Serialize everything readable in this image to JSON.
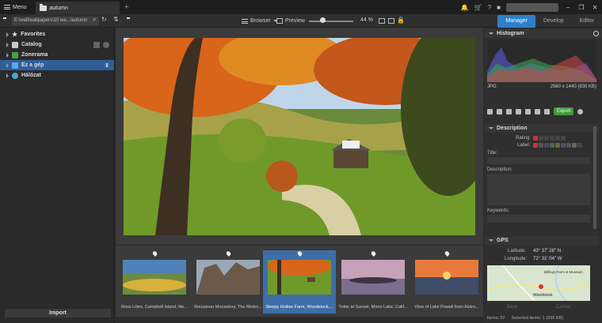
{
  "titlebar": {
    "menu_label": "Menu",
    "tab_label": "autumn",
    "add_tab": "+",
    "icons": [
      "bell-icon",
      "cart-icon",
      "help-icon",
      "gift-icon"
    ],
    "window_controls": [
      "–",
      "❐",
      "✕"
    ]
  },
  "toolbar": {
    "path": "E:\\wall\\wallpapers\\10 wa...\\autumn",
    "browser_label": "Browser",
    "preview_label": "Preview",
    "zoom_value": "44 %",
    "zoom_fraction": 0.3
  },
  "modes": {
    "manager": "Manager",
    "develop": "Develop",
    "editor": "Editor"
  },
  "sidebar": {
    "items": [
      {
        "label": "Favorites",
        "color": "#e0e0e0"
      },
      {
        "label": "Catalog",
        "color": "#c8c8c8"
      },
      {
        "label": "Zonerama",
        "color": "#3fa447"
      },
      {
        "label": "Ez a gép",
        "color": "#59a8e8"
      },
      {
        "label": "Hálózat",
        "color": "#4aa6d8"
      }
    ],
    "import_label": "Import"
  },
  "filmstrip": [
    {
      "caption": "Ross Lilies, Campbell Island, Ne..."
    },
    {
      "caption": "Rousanou Monastery, The Meteo..."
    },
    {
      "caption": "Sleepy Hollow Farm, Woodstock,..."
    },
    {
      "caption": "Tufas at Sunset, Mono Lake, Calif..."
    },
    {
      "caption": "View of Lake Powell from Alstro..."
    }
  ],
  "right": {
    "histogram_title": "Histogram",
    "file_type": "JPG",
    "file_dims": "2560 x 1440 (930 KB)",
    "export_label": "Export",
    "description_title": "Description",
    "rating_label": "Rating:",
    "label_label": "Label:",
    "title_label": "Title:",
    "desc_label": "Description:",
    "keywords_label": "Keywords:",
    "gps_title": "GPS",
    "latitude_label": "Latitude:",
    "latitude_value": "43° 37' 28\" N",
    "longitude_label": "Longitude:",
    "longitude_value": "72° 31' 04\" W",
    "map_label_1": "Billings Farm & Museum",
    "map_label_2": "Woodstock",
    "save_label": "Save",
    "cancel_label": "Cancel"
  },
  "status": {
    "items": "Items: 57",
    "selected": "Selected items: 1 (930 KB)"
  },
  "colors": {
    "accent": "#2d80c9",
    "export_green": "#3f9a3f",
    "selection": "#2f5f99"
  }
}
